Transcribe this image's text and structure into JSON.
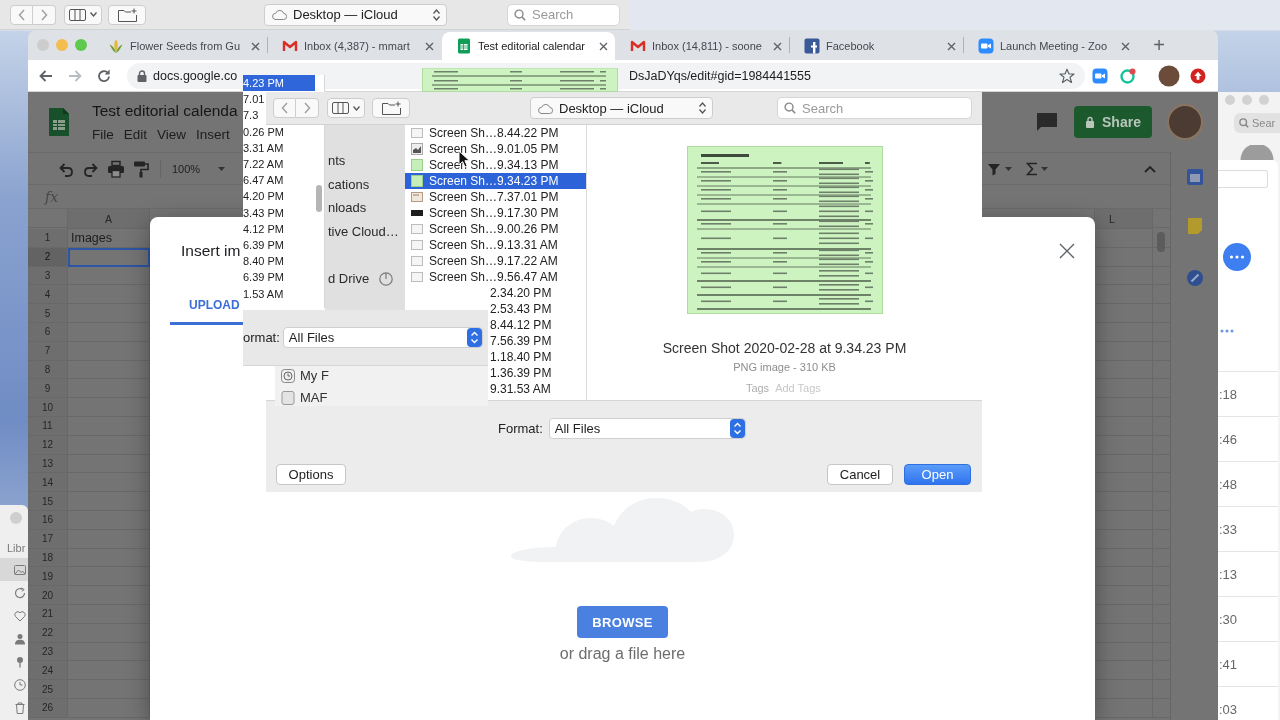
{
  "finder_toolbar": {
    "location": "Desktop — iCloud",
    "search": {
      "placeholder": "Search"
    }
  },
  "browser": {
    "tabs": [
      {
        "title": "Flower Seeds from Gu",
        "kind": "seeds",
        "selected": false
      },
      {
        "title": "Inbox (4,387) - mmart",
        "kind": "mail",
        "selected": false
      },
      {
        "title": "Test editorial calendar",
        "kind": "sheets",
        "selected": true
      },
      {
        "title": "Inbox (14,811) - soone",
        "kind": "mail",
        "selected": false
      },
      {
        "title": "Facebook",
        "kind": "social",
        "selected": false
      },
      {
        "title": "Launch Meeting - Zoo",
        "kind": "video",
        "selected": false
      }
    ],
    "new_tab": "+",
    "address": {
      "host": "docs.google.co",
      "path": "DsJaDYqs/edit#gid=1984441555"
    }
  },
  "sheets": {
    "title": "Test editorial calenda",
    "menu": [
      "File",
      "Edit",
      "View",
      "Insert"
    ],
    "share": "Share",
    "zoom": "100%",
    "formula_label": "fx",
    "columns": [
      {
        "label": "A"
      },
      {
        "label": "L"
      }
    ],
    "rows": [
      {
        "number": "1",
        "value": "Images",
        "selected": false
      },
      {
        "number": "2",
        "selected": true
      },
      {
        "number": "3",
        "selected": false
      },
      {
        "number": "4",
        "selected": false
      },
      {
        "number": "5",
        "selected": false
      },
      {
        "number": "6",
        "selected": false
      },
      {
        "number": "7",
        "selected": false
      },
      {
        "number": "8",
        "selected": false
      },
      {
        "number": "9",
        "selected": false
      },
      {
        "number": "10",
        "selected": false
      },
      {
        "number": "11",
        "selected": false
      },
      {
        "number": "12",
        "selected": false
      },
      {
        "number": "13",
        "selected": false
      },
      {
        "number": "14",
        "selected": false
      },
      {
        "number": "15",
        "selected": false
      },
      {
        "number": "16",
        "selected": false
      },
      {
        "number": "17",
        "selected": false
      },
      {
        "number": "18",
        "selected": false
      },
      {
        "number": "19",
        "selected": false
      },
      {
        "number": "20",
        "selected": false
      },
      {
        "number": "21",
        "selected": false
      },
      {
        "number": "22",
        "selected": false
      },
      {
        "number": "23",
        "selected": false
      },
      {
        "number": "24",
        "selected": false
      },
      {
        "number": "25",
        "selected": false
      },
      {
        "number": "26",
        "selected": false
      }
    ]
  },
  "insert_dialog": {
    "title": "Insert im",
    "tabs": [
      {
        "label": "UPLOAD",
        "selected": true
      }
    ],
    "browse": "BROWSE",
    "hint": "or drag a file here"
  },
  "ghost_list": [
    {
      "time": "4.23 PM",
      "selected": true
    },
    {
      "time": "7.01",
      "selected": false
    },
    {
      "time": "7.3",
      "selected": false
    },
    {
      "time": "0.26 PM",
      "selected": false
    },
    {
      "time": "3.31 AM",
      "selected": false
    },
    {
      "time": "7.22 AM",
      "selected": false
    },
    {
      "time": "6.47 AM",
      "selected": false
    },
    {
      "time": "4.20 PM",
      "selected": false
    },
    {
      "time": "3.43 PM",
      "selected": false
    },
    {
      "time": "4.12 PM",
      "selected": false
    },
    {
      "time": "6.39 PM",
      "selected": false
    },
    {
      "time": "8.40 PM",
      "selected": false
    },
    {
      "time": "6.39 PM",
      "selected": false
    },
    {
      "time": "1.53 AM",
      "selected": false
    }
  ],
  "open_panel": {
    "location": "Desktop — iCloud",
    "search": {
      "placeholder": "Search"
    },
    "sidebar": [
      {
        "items": [
          {
            "label": "nts",
            "syncing": false
          },
          {
            "label": "cations",
            "syncing": false
          },
          {
            "label": "nloads",
            "syncing": false
          },
          {
            "label": "tive Cloud…",
            "syncing": false
          }
        ]
      },
      {
        "items": [
          {
            "label": "d Drive",
            "syncing": true
          }
        ]
      }
    ],
    "files": [
      {
        "name": "Screen Sh…8.44.22 PM",
        "kind": "plain",
        "selected": false
      },
      {
        "name": "Screen Sh…9.01.05 PM",
        "kind": "picture",
        "selected": false
      },
      {
        "name": "Screen Sh…9.34.13 PM",
        "kind": "green",
        "selected": false
      },
      {
        "name": "Screen Sh…9.34.23 PM",
        "kind": "green",
        "selected": true
      },
      {
        "name": "Screen Sh…7.37.01 PM",
        "kind": "beige",
        "selected": false
      },
      {
        "name": "Screen Sh…9.17.30 PM",
        "kind": "dark",
        "selected": false
      },
      {
        "name": "Screen Sh…9.00.26 PM",
        "kind": "plain",
        "selected": false
      },
      {
        "name": "Screen Sh…9.13.31 AM",
        "kind": "plain",
        "selected": false
      },
      {
        "name": "Screen Sh…9.17.22 AM",
        "kind": "plain",
        "selected": false
      },
      {
        "name": "Screen Sh…9.56.47 AM",
        "kind": "plain",
        "selected": false
      }
    ],
    "faded_times": [
      "2.34.20 PM",
      "2.53.43 PM",
      "8.44.12 PM",
      "7.56.39 PM",
      "1.18.40 PM",
      "1.36.39 PM",
      "9.31.53 AM"
    ],
    "preview": {
      "name": "Screen Shot 2020-02-28 at 9.34.23 PM",
      "info": "PNG image - 310 KB",
      "tags_label": "Tags",
      "tags_placeholder": "Add Tags"
    },
    "format": {
      "label": "Format:",
      "value": "All Files"
    },
    "options": "Options",
    "actions": [
      {
        "label": "Cancel",
        "default": false
      },
      {
        "label": "Open",
        "default": true
      }
    ]
  },
  "ghost_format": {
    "label": "ormat:",
    "value": "All Files"
  },
  "ghost_sidebar": [
    {
      "label": "My F",
      "kind": "history"
    },
    {
      "label": "MAF",
      "kind": "disk"
    }
  ],
  "right_window": {
    "search": {
      "placeholder": "Sear"
    },
    "times": [
      ":18",
      ":46",
      ":48",
      ":33",
      ":13",
      ":30",
      ":41",
      ":03"
    ]
  },
  "left_window": {
    "label": "Libr",
    "items": [
      {
        "kind": "image",
        "selected": true
      },
      {
        "kind": "refresh",
        "selected": false
      },
      {
        "kind": "heart",
        "selected": false
      },
      {
        "kind": "person",
        "selected": false
      },
      {
        "kind": "pin",
        "selected": false
      },
      {
        "kind": "clock",
        "selected": false
      },
      {
        "kind": "trash",
        "selected": false
      }
    ]
  }
}
